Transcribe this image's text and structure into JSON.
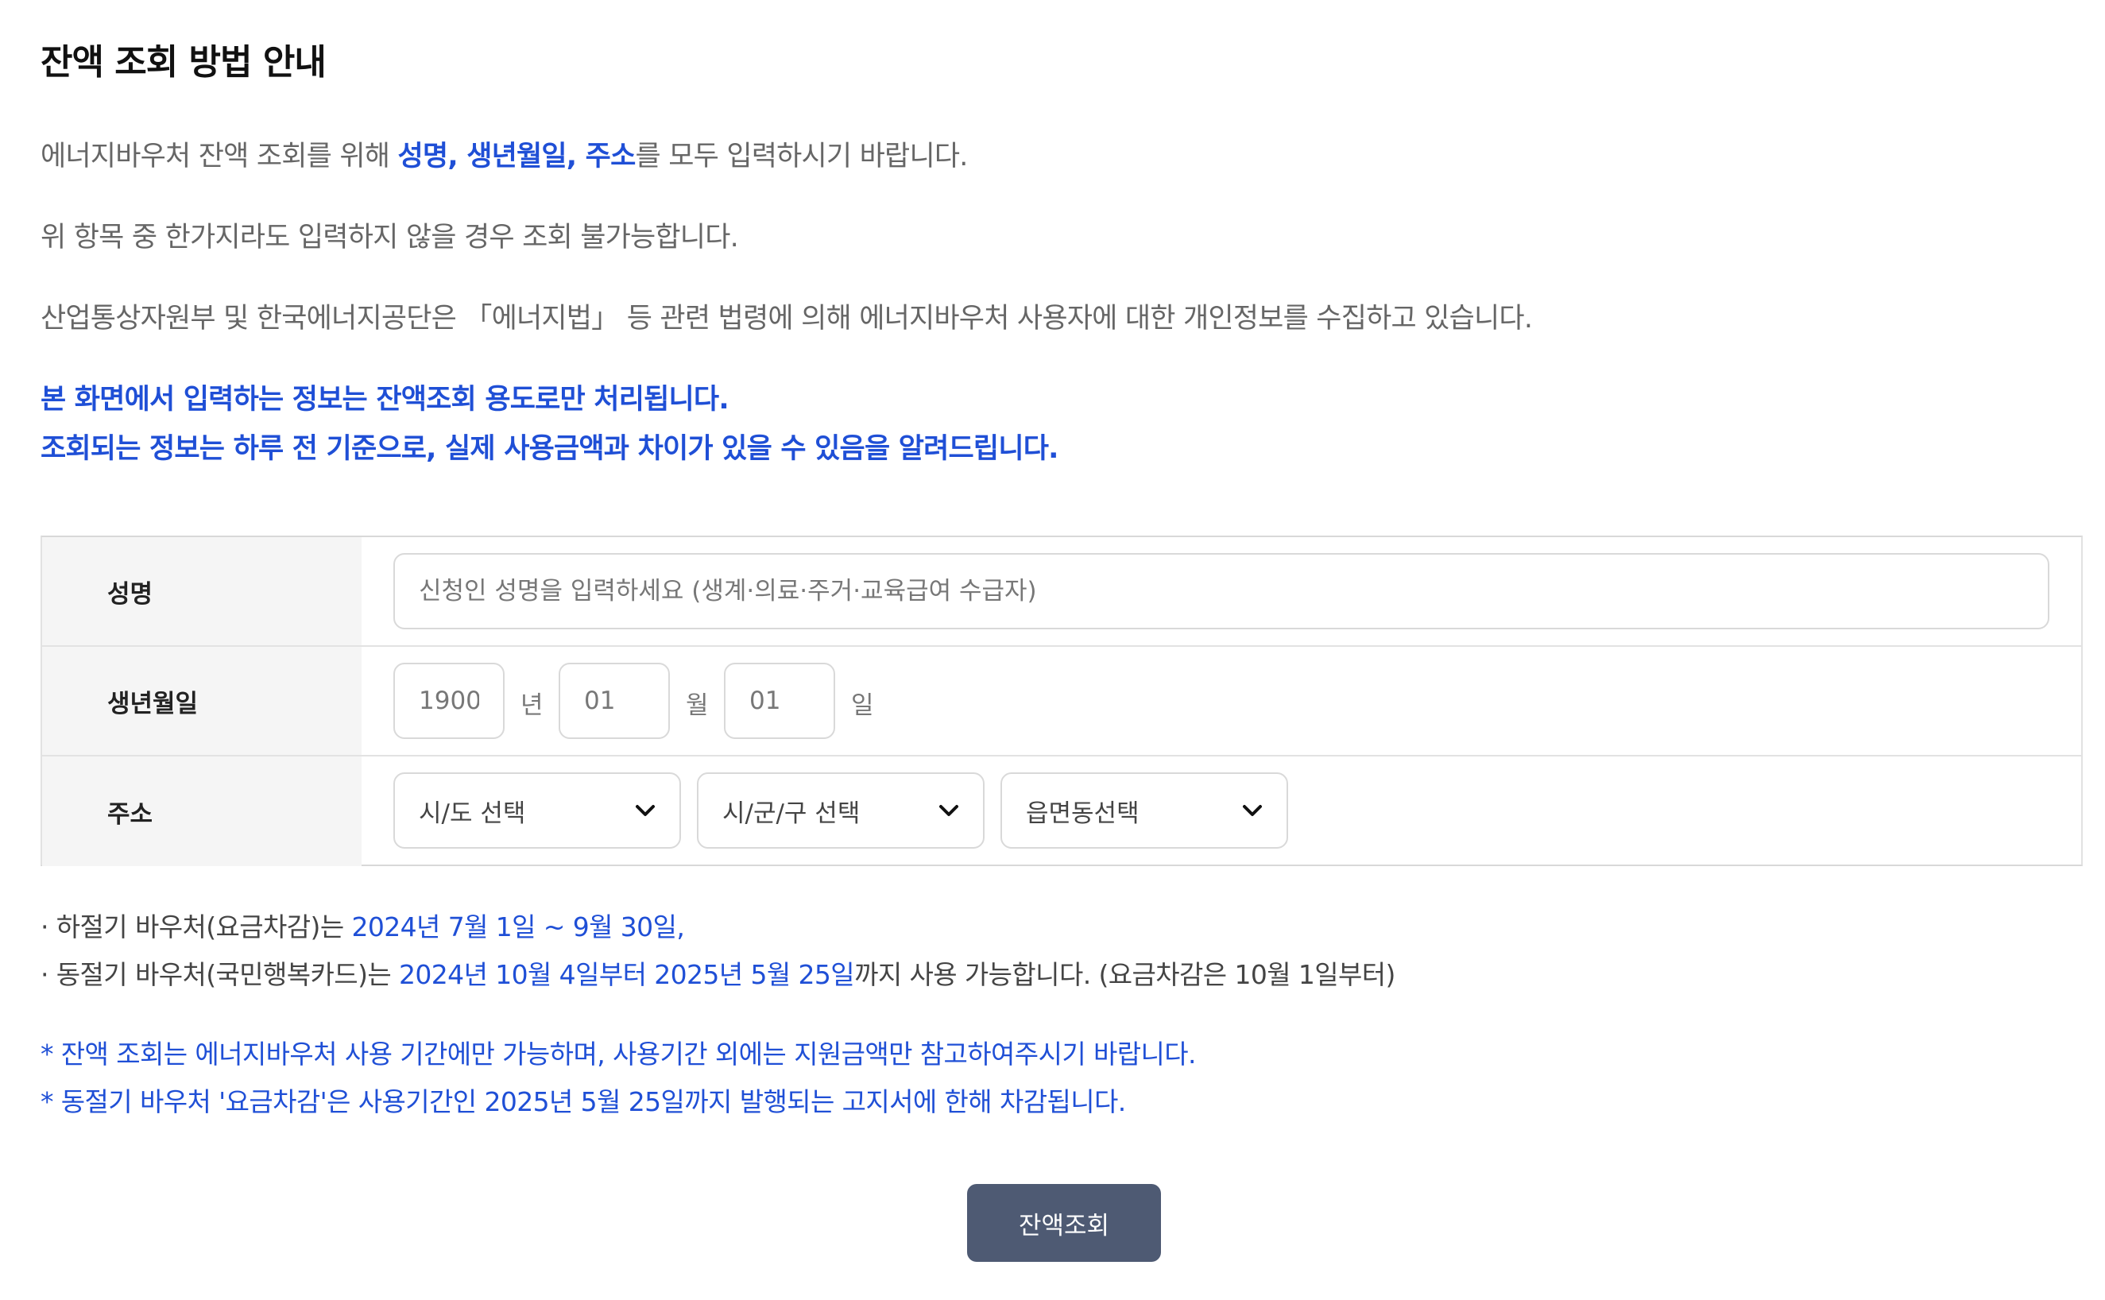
{
  "title": "잔액 조회 방법 안내",
  "guide": {
    "line1": {
      "pre": "에너지바우처 잔액 조회를 위해 ",
      "highlight": "성명, 생년월일, 주소",
      "post": "를 모두 입력하시기 바랍니다."
    },
    "line2": "위 항목 중 한가지라도 입력하지 않을 경우 조회 불가능합니다.",
    "line3": "산업통상자원부 및 한국에너지공단은 「에너지법」 등 관련 법령에 의해 에너지바우처 사용자에 대한 개인정보를 수집하고 있습니다.",
    "line4": "본 화면에서 입력하는 정보는 잔액조회 용도로만 처리됩니다.",
    "line5": "조회되는 정보는 하루 전 기준으로, 실제 사용금액과 차이가 있을 수 있음을 알려드립니다."
  },
  "form": {
    "name": {
      "label": "성명",
      "placeholder": "신청인 성명을 입력하세요 (생계·의료·주거·교육급여 수급자)"
    },
    "birth": {
      "label": "생년월일",
      "year_placeholder": "1900",
      "year_unit": "년",
      "month_placeholder": "01",
      "month_unit": "월",
      "day_placeholder": "01",
      "day_unit": "일"
    },
    "address": {
      "label": "주소",
      "sido": "시/도 선택",
      "sigungu": "시/군/구 선택",
      "eupmyeondong": "읍면동선택"
    }
  },
  "notices": {
    "summer": {
      "pre": "· 하절기 바우처(요금차감)는 ",
      "period": "2024년 7월 1일 ~ 9월 30일,"
    },
    "winter": {
      "pre": "· 동절기 바우처(국민행복카드)는 ",
      "period": "2024년 10월 4일부터 2025년 5월 25일",
      "post": "까지 사용 가능합니다. (요금차감은 10월 1일부터)"
    },
    "note1": "* 잔액 조회는 에너지바우처 사용 기간에만 가능하며, 사용기간 외에는 지원금액만 참고하여주시기 바랍니다.",
    "note2": "* 동절기 바우처 '요금차감'은 사용기간인 2025년 5월 25일까지 발행되는 고지서에 한해 차감됩니다."
  },
  "submit_label": "잔액조회",
  "colors": {
    "accent": "#1f4fd6",
    "button": "#4e5a73",
    "label_bg": "#f5f5f5"
  }
}
